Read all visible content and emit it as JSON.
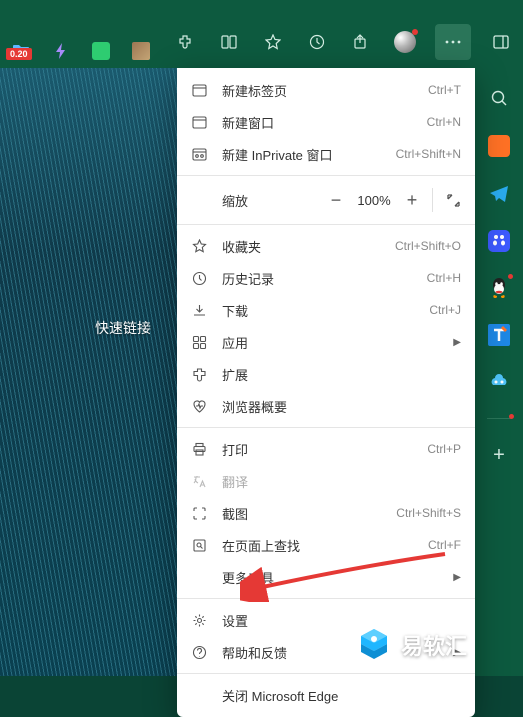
{
  "toolbar": {
    "badge": "0.20"
  },
  "content": {
    "quick_links": "快速链接"
  },
  "menu": {
    "new_tab": {
      "label": "新建标签页",
      "shortcut": "Ctrl+T"
    },
    "new_window": {
      "label": "新建窗口",
      "shortcut": "Ctrl+N"
    },
    "new_inprivate": {
      "label": "新建 InPrivate 窗口",
      "shortcut": "Ctrl+Shift+N"
    },
    "zoom": {
      "label": "缩放",
      "value": "100%"
    },
    "favorites": {
      "label": "收藏夹",
      "shortcut": "Ctrl+Shift+O"
    },
    "history": {
      "label": "历史记录",
      "shortcut": "Ctrl+H"
    },
    "downloads": {
      "label": "下载",
      "shortcut": "Ctrl+J"
    },
    "apps": {
      "label": "应用"
    },
    "extensions": {
      "label": "扩展"
    },
    "browser_essentials": {
      "label": "浏览器概要"
    },
    "print": {
      "label": "打印",
      "shortcut": "Ctrl+P"
    },
    "translate": {
      "label": "翻译"
    },
    "screenshot": {
      "label": "截图",
      "shortcut": "Ctrl+Shift+S"
    },
    "find": {
      "label": "在页面上查找",
      "shortcut": "Ctrl+F"
    },
    "more_tools": {
      "label": "更多工具"
    },
    "settings": {
      "label": "设置"
    },
    "help": {
      "label": "帮助和反馈"
    },
    "close": {
      "label": "关闭 Microsoft Edge"
    }
  },
  "watermark": {
    "text": "易软汇"
  }
}
